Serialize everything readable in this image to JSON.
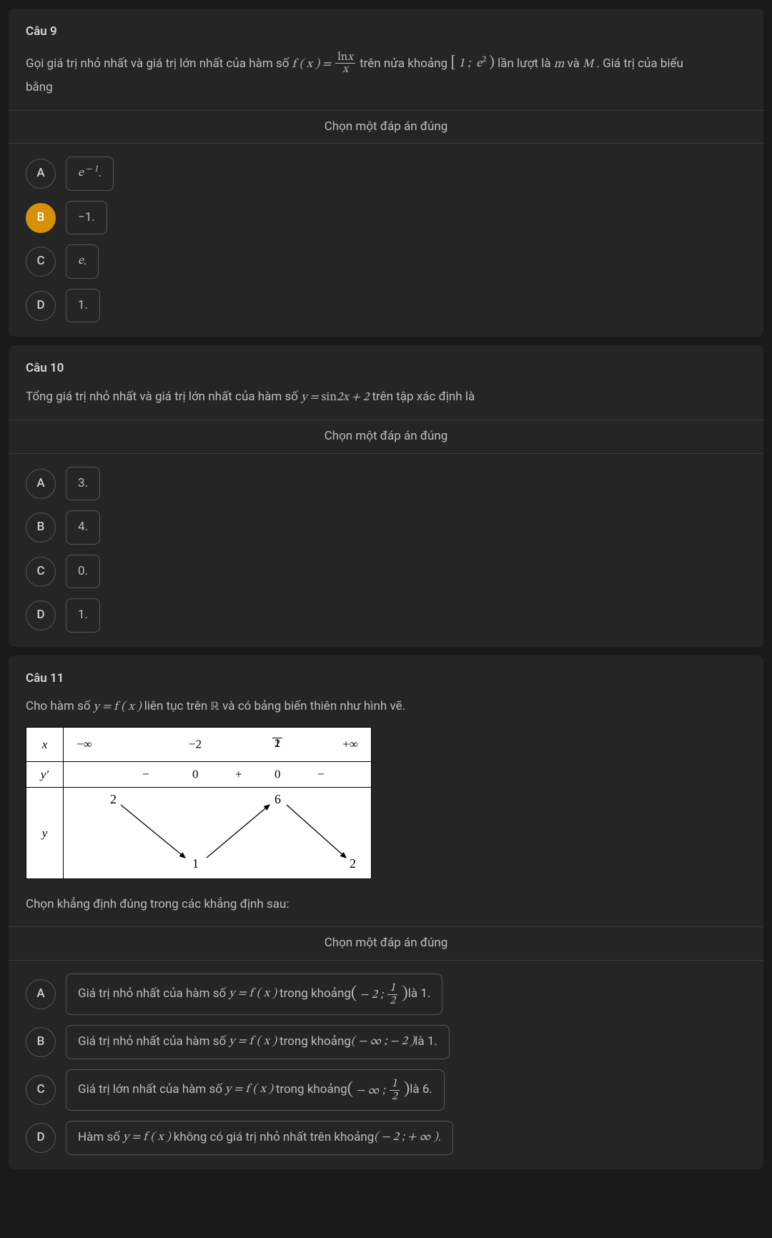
{
  "q9": {
    "title": "Câu 9",
    "text_pre": "Gọi giá trị nhỏ nhất và giá trị lớn nhất của hàm số ",
    "fx": "f ( x ) = ",
    "frac_num": "ln",
    "frac_num_x": "x",
    "frac_den": "x",
    "text_mid": " trên nửa khoảng ",
    "interval": "[ 1 ;  e² )",
    "text_post1": " lần lượt là ",
    "m": "m",
    "text_post2": " và ",
    "M": "M",
    "text_post3": ". Giá trị của biểu",
    "text_line2": "bằng",
    "instruction": "Chọn một đáp án đúng",
    "opts": {
      "A": {
        "letter": "A",
        "pre": "e",
        "sup": " − 1",
        "post": "."
      },
      "B": {
        "letter": "B",
        "text": "−1."
      },
      "C": {
        "letter": "C",
        "pre": "e",
        "post": "."
      },
      "D": {
        "letter": "D",
        "text": "1."
      }
    }
  },
  "q10": {
    "title": "Câu 10",
    "text_pre": "Tổng giá trị nhỏ nhất và giá trị lớn nhất của hàm số ",
    "func": "y = sin2x + 2",
    "text_post": " trên tập xác định là",
    "instruction": "Chọn một đáp án đúng",
    "opts": {
      "A": {
        "letter": "A",
        "text": "3."
      },
      "B": {
        "letter": "B",
        "text": "4."
      },
      "C": {
        "letter": "C",
        "text": "0."
      },
      "D": {
        "letter": "D",
        "text": "1."
      }
    }
  },
  "q11": {
    "title": "Câu 11",
    "text_pre": "Cho hàm số ",
    "func": "y = f ( x )",
    "text_mid": " liên tục trên ",
    "R": "ℝ",
    "text_post": " và có bảng biến thiên như hình vẽ.",
    "text_after_table": "Chọn khẳng định đúng trong các khẳng định sau:",
    "instruction": "Chọn một đáp án đúng",
    "table": {
      "x_label": "x",
      "yp_label": "y′",
      "y_label": "y",
      "x_vals": {
        "ninf": "−∞",
        "m2": "−2",
        "half_num": "1",
        "half_den": "2",
        "pinf": "+∞"
      },
      "yp_vals": {
        "s1": "−",
        "z1": "0",
        "s2": "+",
        "z2": "0",
        "s3": "−"
      },
      "y_vals": {
        "tl": "2",
        "bm": "1",
        "tm": "6",
        "br": "2"
      }
    },
    "opts": {
      "A": {
        "letter": "A",
        "p1": "Giá trị nhỏ nhất của hàm số ",
        "f": "y = f ( x )",
        "p2": " trong khoảng ",
        "lpar": "( − 2 ; ",
        "half_num": "1",
        "half_den": "2",
        "rpar": " )",
        "p3": " là 1."
      },
      "B": {
        "letter": "B",
        "p1": "Giá trị nhỏ nhất của hàm số ",
        "f": "y = f ( x )",
        "p2": " trong khoảng ",
        "interval": "( − ∞ ; − 2 )",
        "p3": " là 1."
      },
      "C": {
        "letter": "C",
        "p1": "Giá trị lớn nhất của hàm số ",
        "f": "y = f ( x )",
        "p2": " trong khoảng ",
        "lpar": "( − ∞ ; ",
        "half_num": "1",
        "half_den": "2",
        "rpar": " )",
        "p3": " là 6."
      },
      "D": {
        "letter": "D",
        "p1": "Hàm số ",
        "f": "y = f ( x )",
        "p2": " không có giá trị nhỏ nhất trên khoảng ",
        "interval": "( − 2 ; + ∞ )",
        "p3": "."
      }
    }
  }
}
